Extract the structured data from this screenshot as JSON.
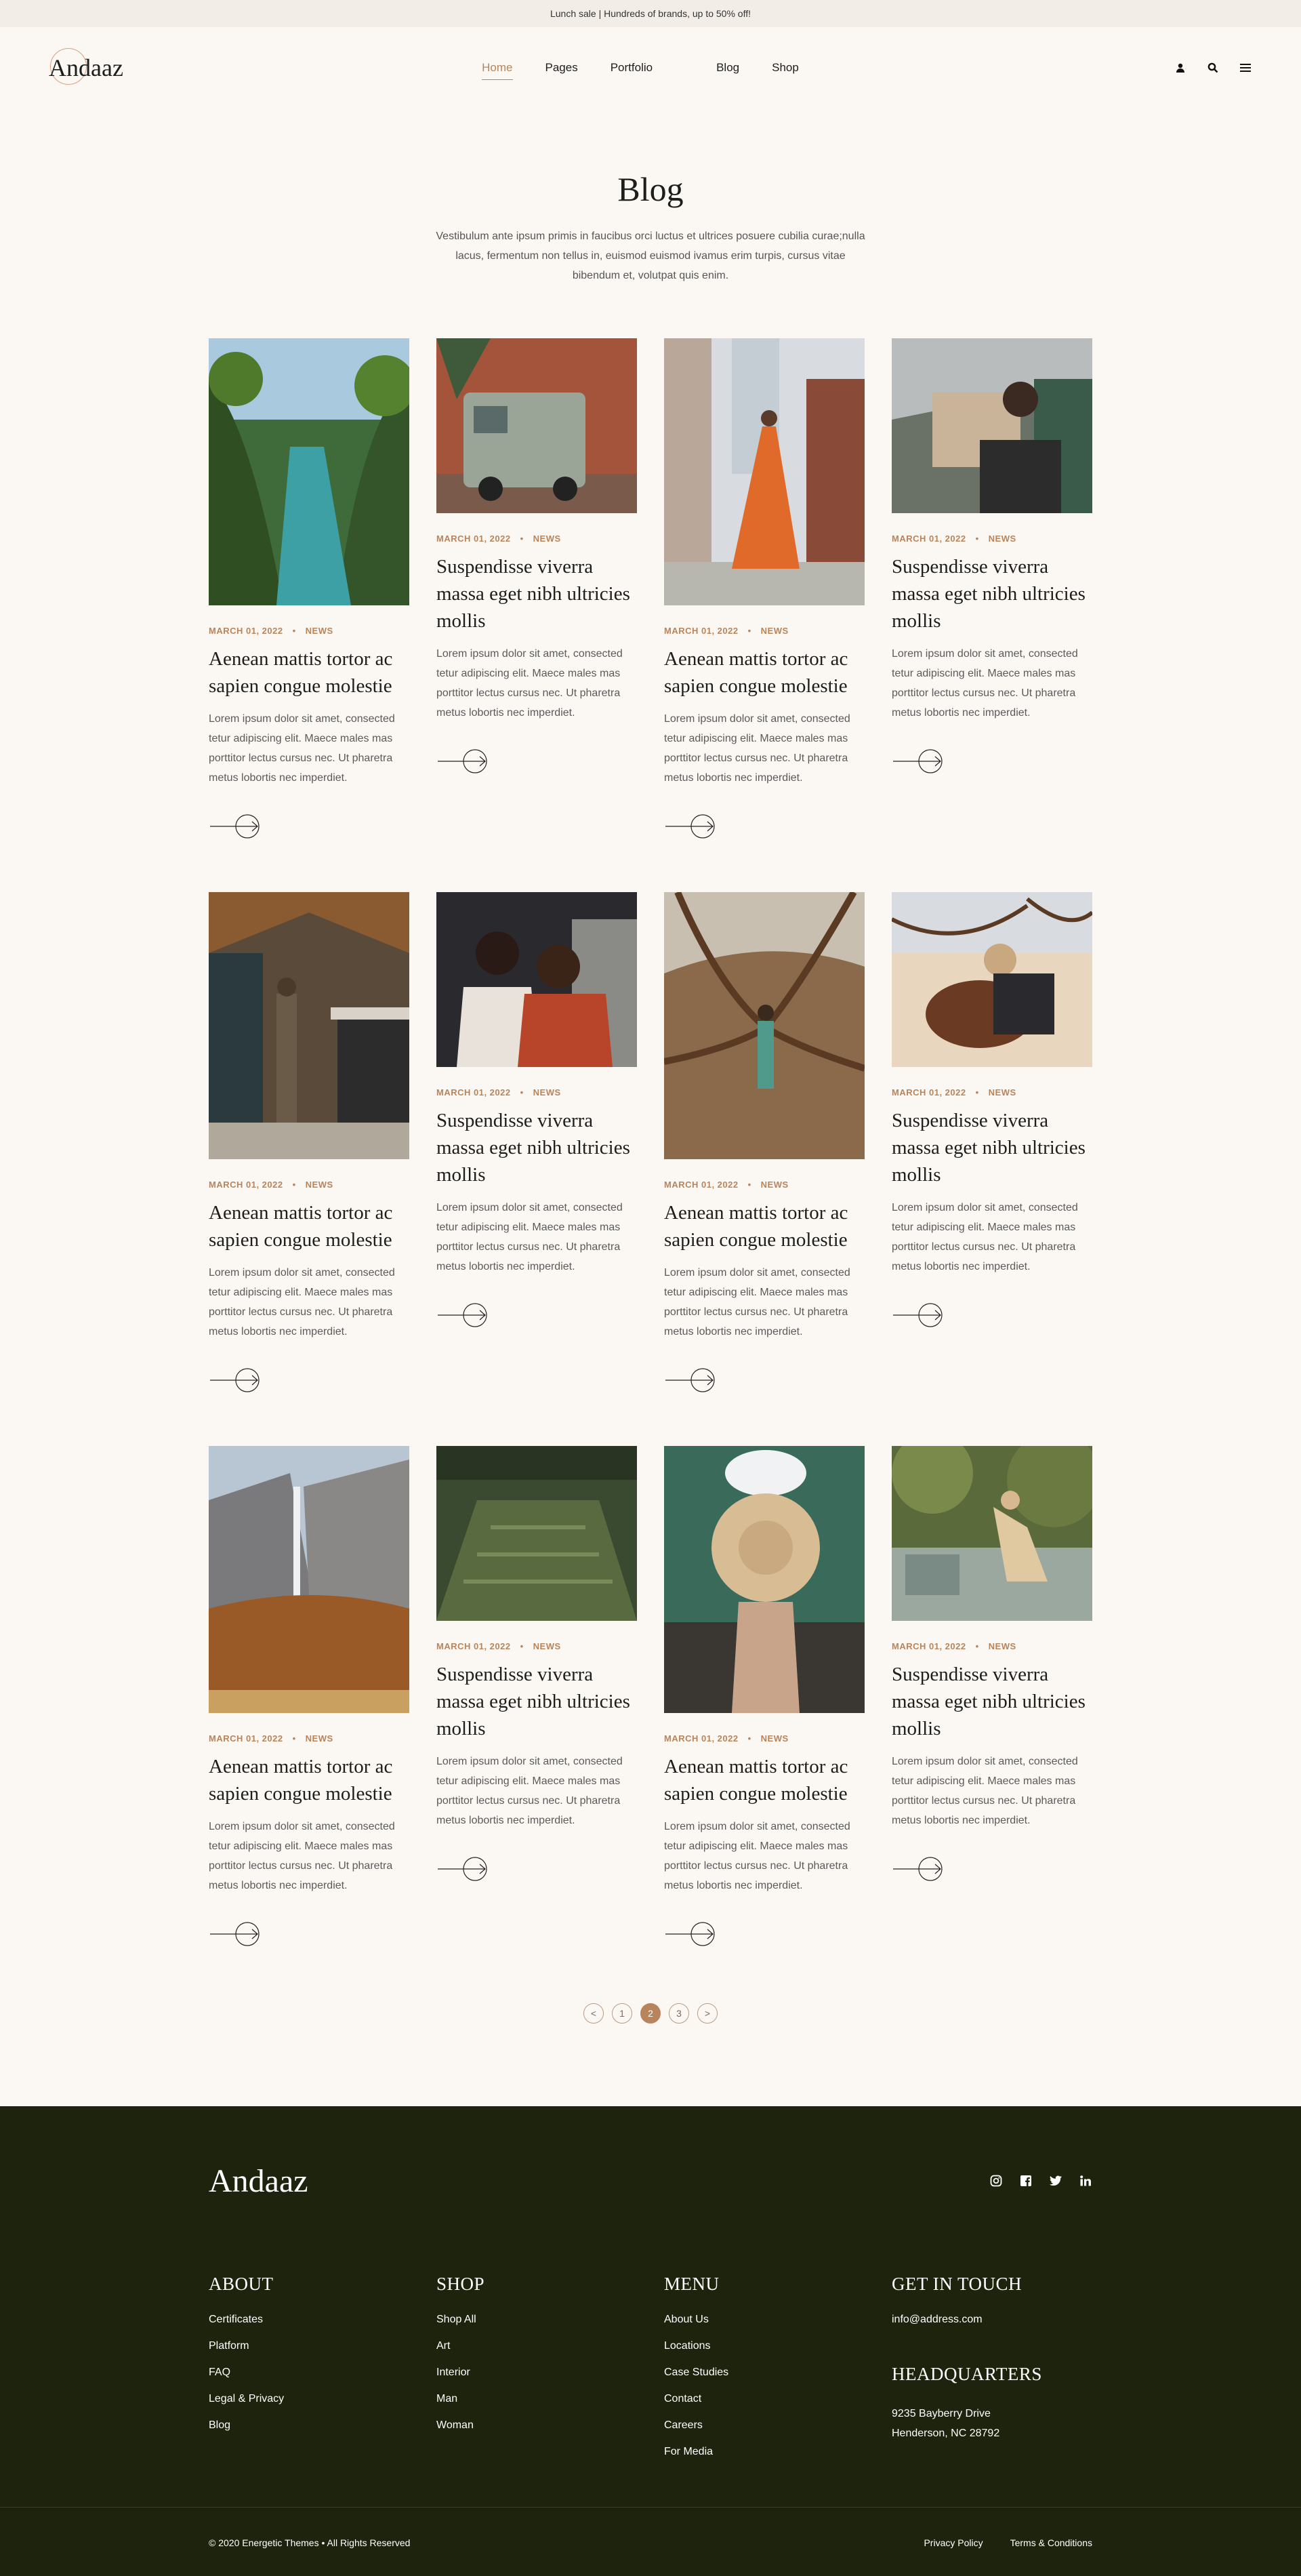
{
  "topbar": {
    "text": "Lunch sale | Hundreds of brands, up to 50% off!"
  },
  "header": {
    "logo": "Andaaz",
    "nav": [
      "Home",
      "Pages",
      "Portfolio",
      "Blog",
      "Shop"
    ]
  },
  "intro": {
    "title": "Blog",
    "text": "Vestibulum ante ipsum primis in faucibus orci luctus et ultrices posuere cubilia curae;nulla lacus, fermentum non tellus in, euismod euismod ivamus erim turpis, cursus vitae bibendum et, volutpat quis enim."
  },
  "posts": [
    {
      "date": "MARCH 01, 2022",
      "cat": "NEWS",
      "title": "Aenean mattis tortor ac sapien congue molestie",
      "excerpt": "Lorem ipsum dolor sit amet,  consected tetur adipiscing elit. Maece males mas porttitor lectus cursus nec. Ut pharetra metus lobortis nec imperdiet."
    },
    {
      "date": "MARCH 01, 2022",
      "cat": "NEWS",
      "title": "Suspendisse viverra massa eget nibh ultricies mollis",
      "excerpt": "Lorem ipsum dolor sit amet,  consected tetur adipiscing elit. Maece males mas porttitor lectus cursus nec. Ut pharetra metus lobortis nec imperdiet."
    },
    {
      "date": "MARCH 01, 2022",
      "cat": "NEWS",
      "title": "Aenean mattis tortor ac sapien congue molestie",
      "excerpt": "Lorem ipsum dolor sit amet,  consected tetur adipiscing elit. Maece males mas porttitor lectus cursus nec. Ut pharetra metus lobortis nec imperdiet."
    },
    {
      "date": "MARCH 01, 2022",
      "cat": "NEWS",
      "title": "Suspendisse viverra massa eget nibh ultricies mollis",
      "excerpt": "Lorem ipsum dolor sit amet,  consected tetur adipiscing elit. Maece males mas porttitor lectus cursus nec. Ut pharetra metus lobortis nec imperdiet."
    },
    {
      "date": "MARCH 01, 2022",
      "cat": "NEWS",
      "title": "Aenean mattis tortor ac sapien congue molestie",
      "excerpt": "Lorem ipsum dolor sit amet,  consected tetur adipiscing elit. Maece males mas porttitor lectus cursus nec. Ut pharetra metus lobortis nec imperdiet."
    },
    {
      "date": "MARCH 01, 2022",
      "cat": "NEWS",
      "title": "Suspendisse viverra massa eget nibh ultricies mollis",
      "excerpt": "Lorem ipsum dolor sit amet,  consected tetur adipiscing elit. Maece males mas porttitor lectus cursus nec. Ut pharetra metus lobortis nec imperdiet."
    },
    {
      "date": "MARCH 01, 2022",
      "cat": "NEWS",
      "title": "Aenean mattis tortor ac sapien congue molestie",
      "excerpt": "Lorem ipsum dolor sit amet,  consected tetur adipiscing elit. Maece males mas porttitor lectus cursus nec. Ut pharetra metus lobortis nec imperdiet."
    },
    {
      "date": "MARCH 01, 2022",
      "cat": "NEWS",
      "title": "Suspendisse viverra massa eget nibh ultricies mollis",
      "excerpt": "Lorem ipsum dolor sit amet,  consected tetur adipiscing elit. Maece males mas porttitor lectus cursus nec. Ut pharetra metus lobortis nec imperdiet."
    },
    {
      "date": "MARCH 01, 2022",
      "cat": "NEWS",
      "title": "Aenean mattis tortor ac sapien congue molestie",
      "excerpt": "Lorem ipsum dolor sit amet,  consected tetur adipiscing elit. Maece males mas porttitor lectus cursus nec. Ut pharetra metus lobortis nec imperdiet."
    },
    {
      "date": "MARCH 01, 2022",
      "cat": "NEWS",
      "title": "Suspendisse viverra massa eget nibh ultricies mollis",
      "excerpt": "Lorem ipsum dolor sit amet,  consected tetur adipiscing elit. Maece males mas porttitor lectus cursus nec. Ut pharetra metus lobortis nec imperdiet."
    },
    {
      "date": "MARCH 01, 2022",
      "cat": "NEWS",
      "title": "Aenean mattis tortor ac sapien congue molestie",
      "excerpt": "Lorem ipsum dolor sit amet,  consected tetur adipiscing elit. Maece males mas porttitor lectus cursus nec. Ut pharetra metus lobortis nec imperdiet."
    },
    {
      "date": "MARCH 01, 2022",
      "cat": "NEWS",
      "title": "Suspendisse viverra massa eget nibh ultricies mollis",
      "excerpt": "Lorem ipsum dolor sit amet,  consected tetur adipiscing elit. Maece males mas porttitor lectus cursus nec. Ut pharetra metus lobortis nec imperdiet."
    }
  ],
  "pagination": {
    "prev": "<",
    "pages": [
      "1",
      "2",
      "3"
    ],
    "next": ">"
  },
  "footer": {
    "logo": "Andaaz",
    "about": {
      "title": "ABOUT",
      "links": [
        "Certificates",
        "Platform",
        "FAQ",
        "Legal & Privacy",
        "Blog"
      ]
    },
    "shop": {
      "title": "SHOP",
      "links": [
        "Shop All",
        "Art",
        "Interior",
        "Man",
        "Woman"
      ]
    },
    "menu": {
      "title": "MENU",
      "links": [
        "About Us",
        "Locations",
        "Case Studies",
        "Contact",
        "Careers",
        "For Media"
      ]
    },
    "contact": {
      "title": "GET IN TOUCH",
      "email": "info@address.com",
      "hq_title": "HEADQUARTERS",
      "addr1": "9235 Bayberry Drive",
      "addr2": "Henderson, NC 28792"
    },
    "copyright": "© 2020 Energetic Themes • All Rights Reserved",
    "privacy": "Privacy Policy",
    "terms": "Terms & Conditions"
  },
  "colors": {
    "accent": "#b8845b",
    "footer_bg": "#1e230e",
    "page_bg": "#fbf8f4"
  }
}
